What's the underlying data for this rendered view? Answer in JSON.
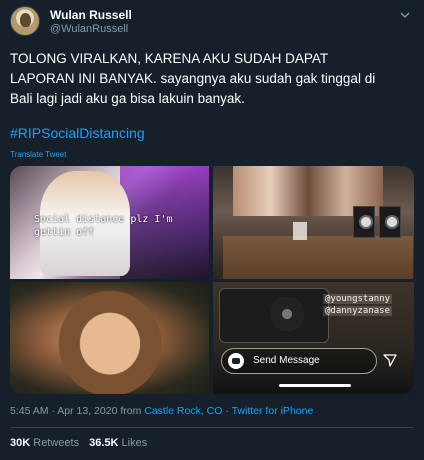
{
  "author": {
    "name": "Wulan Russell",
    "handle": "@WulanRussell"
  },
  "tweet": {
    "line1": "TOLONG VIRALKAN, KARENA AKU SUDAH DAPAT",
    "line2": "LAPORAN INI BANYAK. sayangnya aku sudah gak tinggal di",
    "line3": "Bali lagi jadi aku ga bisa lakuin banyak.",
    "hashtag": "#RIPSocialDistancing",
    "translate_label": "Translate Tweet"
  },
  "media": {
    "caption_line1": "Social distance plz I'm",
    "caption_line2": "gettin off",
    "tag1": "@youngstanny",
    "tag2": "@dannyzanase",
    "message_placeholder": "Send Message"
  },
  "meta": {
    "time_date": "5:45 AM · Apr 13, 2020 from ",
    "location": "Castle Rock, CO",
    "separator": " · ",
    "client": "Twitter for iPhone"
  },
  "stats": {
    "retweets_count": "30K",
    "retweets_label": "Retweets",
    "likes_count": "36.5K",
    "likes_label": "Likes"
  },
  "colors": {
    "background": "#15202b",
    "link": "#1da1f2",
    "secondary_text": "#8899a6"
  },
  "icons": [
    "chevron-down-icon",
    "camera-icon",
    "send-icon"
  ]
}
